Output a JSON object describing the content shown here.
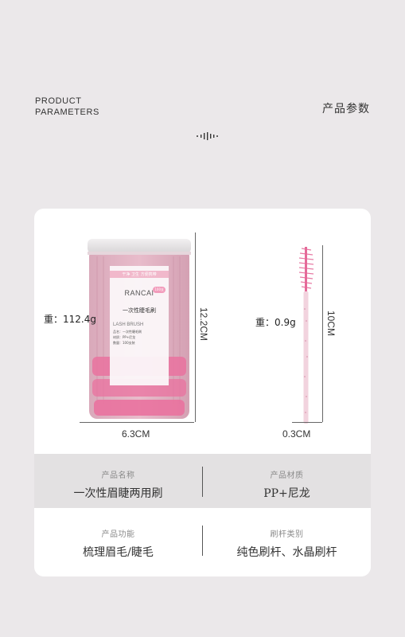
{
  "header": {
    "title_en_line1": "PRODUCT",
    "title_en_line2": "PARAMETERS",
    "title_cn": "产品参数"
  },
  "jar": {
    "brand": "RANCAI",
    "tagline": "干净 卫生 方便携带",
    "product_name": "一次性睫毛刷",
    "product_name_en": "LASH BRUSH",
    "badge": "100支",
    "label_lines": [
      "品名：一次性睫毛刷",
      "材质：PP+尼龙",
      "数量：100支装"
    ]
  },
  "dimensions": {
    "jar_width": "6.3CM",
    "jar_height": "12.2CM",
    "jar_weight": "重：112.4g",
    "wand_width": "0.3CM",
    "wand_height": "10CM",
    "wand_weight": "重：0.9g"
  },
  "params": [
    {
      "left_label": "产品名称",
      "left_value": "一次性眉睫两用刷",
      "right_label": "产品材质",
      "right_value": "PP+尼龙"
    },
    {
      "left_label": "产品功能",
      "left_value": "梳理眉毛/睫毛",
      "right_label": "刷杆类别",
      "right_value": "纯色刷杆、水晶刷杆"
    }
  ],
  "colors": {
    "background": "#ebe8ea",
    "card": "#ffffff",
    "brush_pink": "#e77aa4",
    "row_gray": "#e3e1e2"
  }
}
